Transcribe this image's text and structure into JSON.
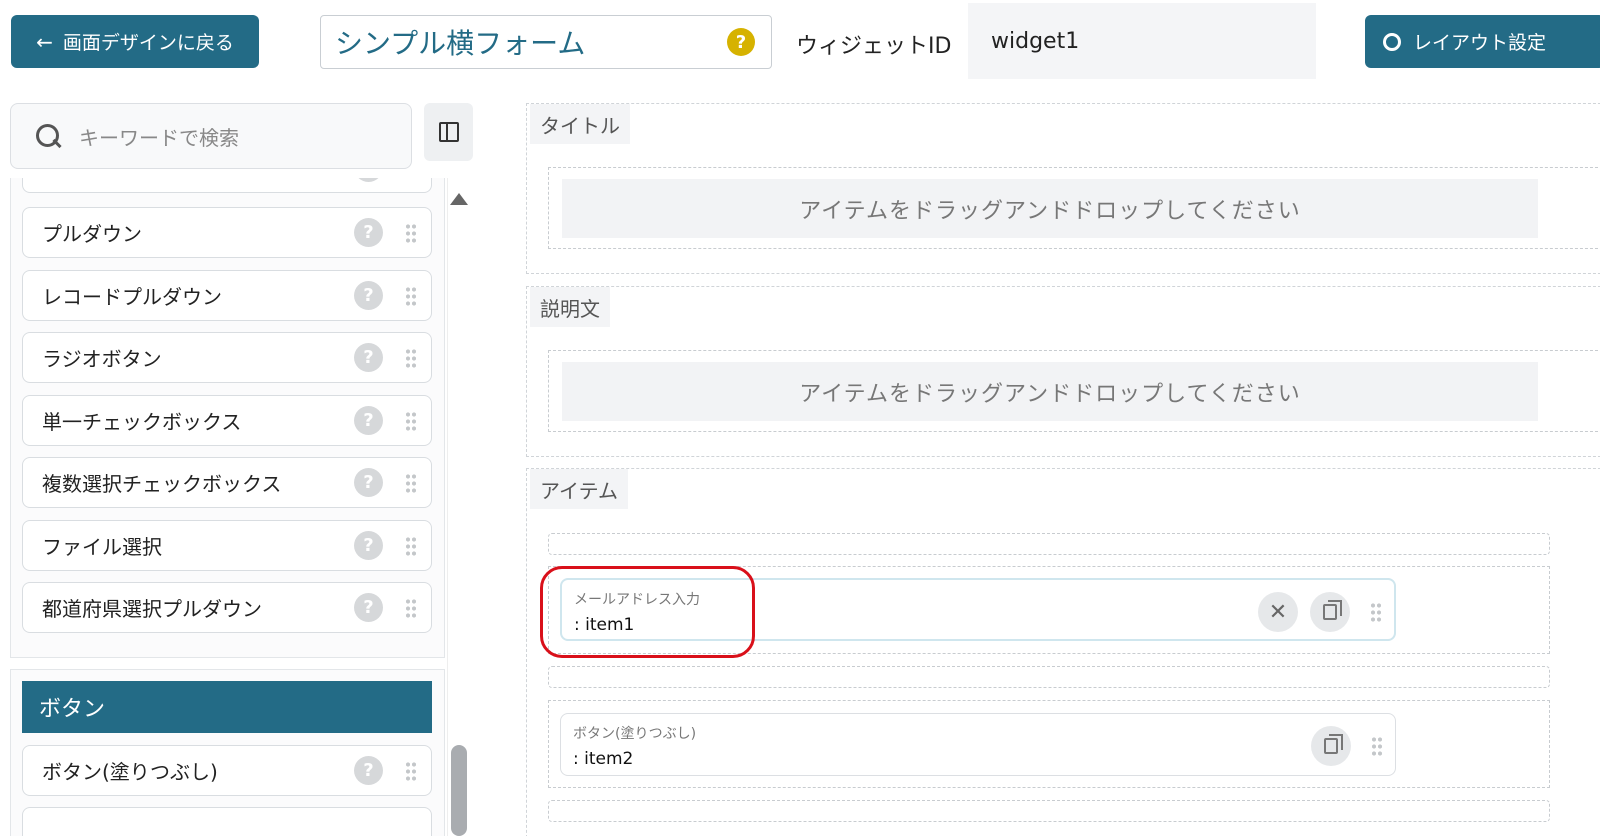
{
  "header": {
    "back_label": "画面デザインに戻る",
    "title": "シンプル横フォーム",
    "widget_id_label": "ウィジェットID",
    "widget_id_value": "widget1",
    "layout_label": "レイアウト設定"
  },
  "sidebar": {
    "search_placeholder": "キーワードで検索",
    "items": [
      {
        "label": "プルダウン"
      },
      {
        "label": "レコードプルダウン"
      },
      {
        "label": "ラジオボタン"
      },
      {
        "label": "単一チェックボックス"
      },
      {
        "label": "複数選択チェックボックス"
      },
      {
        "label": "ファイル選択"
      },
      {
        "label": "都道府県選択プルダウン"
      }
    ],
    "button_section": {
      "title": "ボタン",
      "items": [
        {
          "label": "ボタン(塗りつぶし)"
        }
      ]
    }
  },
  "canvas": {
    "zones": [
      {
        "label": "タイトル",
        "drop_text": "アイテムをドラッグアンドドロップしてください"
      },
      {
        "label": "説明文",
        "drop_text": "アイテムをドラッグアンドドロップしてください"
      },
      {
        "label": "アイテム"
      }
    ],
    "items": [
      {
        "type": "メールアドレス入力",
        "id": ": item1"
      },
      {
        "type": "ボタン(塗りつぶし)",
        "id": ": item2"
      }
    ]
  },
  "colors": {
    "primary": "#236b86",
    "help": "#d6b200",
    "highlight": "#d9101a"
  }
}
